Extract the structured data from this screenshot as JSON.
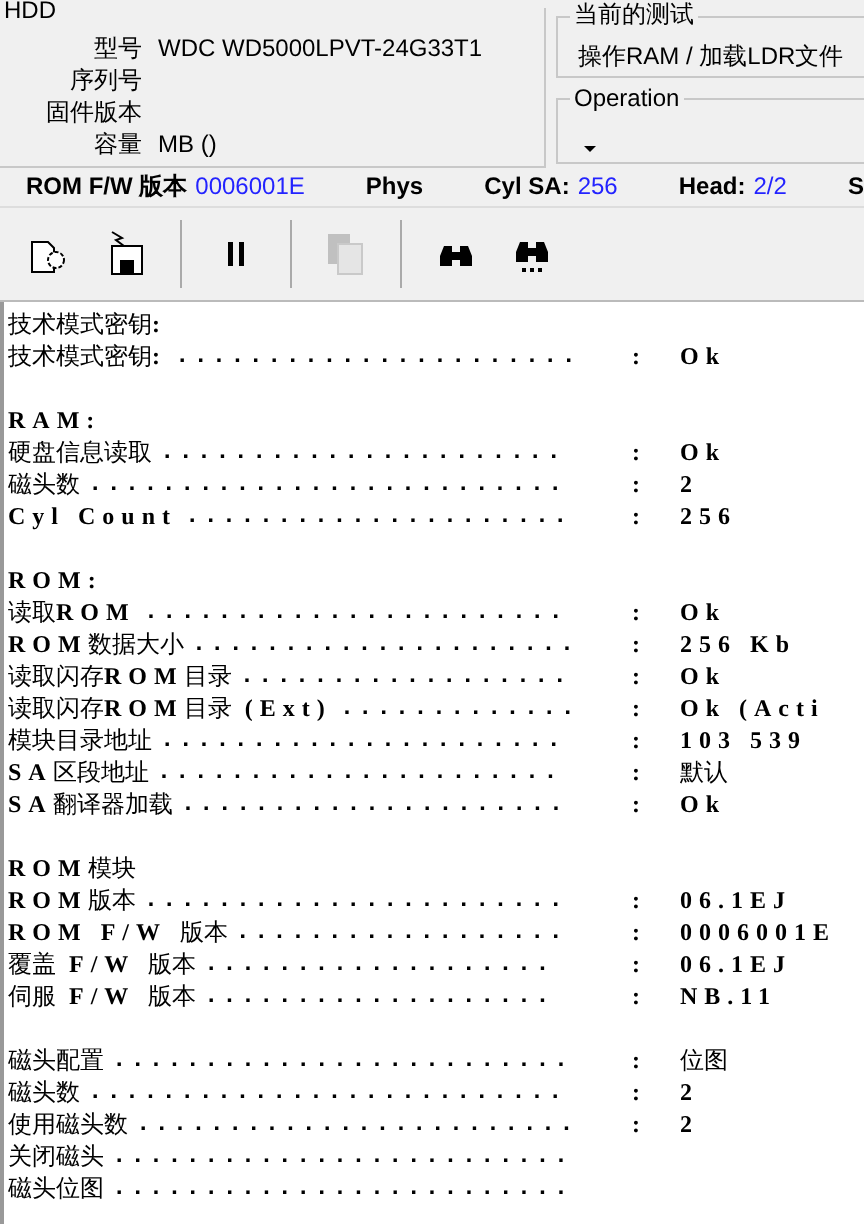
{
  "hdd": {
    "legend": "HDD",
    "fields": [
      {
        "label": "型号",
        "value": "WDC WD5000LPVT-24G33T1"
      },
      {
        "label": "序列号"
      },
      {
        "label": "固件版本"
      },
      {
        "label": "容量",
        "value": "MB ()"
      }
    ]
  },
  "current_test": {
    "legend": "当前的测试",
    "value": "操作RAM / 加载LDR文件"
  },
  "operation": {
    "legend": "Operation"
  },
  "status_bar": [
    {
      "label": "ROM F/W 版本",
      "value": "0006001E"
    },
    {
      "label": "Phys"
    },
    {
      "label": "Cyl SA:",
      "value": "256"
    },
    {
      "label": "Head:",
      "value": "2/2"
    },
    {
      "label": "S"
    }
  ],
  "toolbar": [
    {
      "kind": "button",
      "disabled": false
    },
    {
      "kind": "button",
      "disabled": false
    },
    {
      "kind": "separator"
    },
    {
      "kind": "button",
      "disabled": false
    },
    {
      "kind": "separator"
    },
    {
      "kind": "button",
      "disabled": true
    },
    {
      "kind": "separator"
    },
    {
      "kind": "button",
      "disabled": false
    },
    {
      "kind": "button",
      "disabled": false
    }
  ],
  "log": [
    {
      "kind": "text",
      "text": "技术模式密钥:"
    },
    {
      "kind": "entry",
      "label": "技术模式密钥:",
      "leader": "......................",
      "sep": ":",
      "value": "Ok"
    },
    {
      "kind": "blank"
    },
    {
      "kind": "text",
      "text": "RAM:"
    },
    {
      "kind": "entry",
      "label": "硬盘信息读取",
      "leader": "......................",
      "sep": ":",
      "value": "Ok"
    },
    {
      "kind": "entry",
      "label": "磁头数",
      "leader": "..........................",
      "sep": ":",
      "value": "2"
    },
    {
      "kind": "entry",
      "label": "Cyl Count",
      "leader": ".....................",
      "sep": ":",
      "value": "256"
    },
    {
      "kind": "blank"
    },
    {
      "kind": "text",
      "text": "ROM:"
    },
    {
      "kind": "entry",
      "label": "读取ROM",
      "leader": ".......................",
      "sep": ":",
      "value": "Ok"
    },
    {
      "kind": "entry",
      "label": "ROM数据大小",
      "leader": ".....................",
      "sep": ":",
      "value": "256 Kb"
    },
    {
      "kind": "entry",
      "label": "读取闪存ROM目录",
      "leader": "..................",
      "sep": ":",
      "value": "Ok"
    },
    {
      "kind": "entry",
      "label": "读取闪存ROM目录 (Ext)",
      "leader": ".............",
      "sep": ":",
      "value": "Ok (Acti"
    },
    {
      "kind": "entry",
      "label": "模块目录地址",
      "leader": "......................",
      "sep": ":",
      "value": "103 539"
    },
    {
      "kind": "entry",
      "label": "SA区段地址",
      "leader": "......................",
      "sep": ":",
      "value": "默认"
    },
    {
      "kind": "entry",
      "label": "SA翻译器加载",
      "leader": ".....................",
      "sep": ":",
      "value": "Ok"
    },
    {
      "kind": "blank"
    },
    {
      "kind": "text",
      "text": "ROM模块"
    },
    {
      "kind": "entry",
      "label": "ROM版本",
      "leader": ".......................",
      "sep": ":",
      "value": "06.1EJ"
    },
    {
      "kind": "entry",
      "label": "ROM F/W 版本",
      "leader": "..................",
      "sep": ":",
      "value": "0006001E"
    },
    {
      "kind": "entry",
      "label": "覆盖 F/W 版本",
      "leader": "...................",
      "sep": ":",
      "value": "06.1EJ"
    },
    {
      "kind": "entry",
      "label": "伺服 F/W 版本",
      "leader": "...................",
      "sep": ":",
      "value": "NB.11"
    },
    {
      "kind": "blank"
    },
    {
      "kind": "entry",
      "label": "磁头配置",
      "leader": ".........................",
      "sep": ":",
      "value": "位图"
    },
    {
      "kind": "entry",
      "label": "磁头数",
      "leader": "..........................",
      "sep": ":",
      "value": "2"
    },
    {
      "kind": "entry",
      "label": "使用磁头数",
      "leader": "........................",
      "sep": ":",
      "value": "2"
    },
    {
      "kind": "entry",
      "label": "关闭磁头",
      "leader": "........................."
    },
    {
      "kind": "entry",
      "label": "磁头位图",
      "leader": "........................."
    }
  ]
}
